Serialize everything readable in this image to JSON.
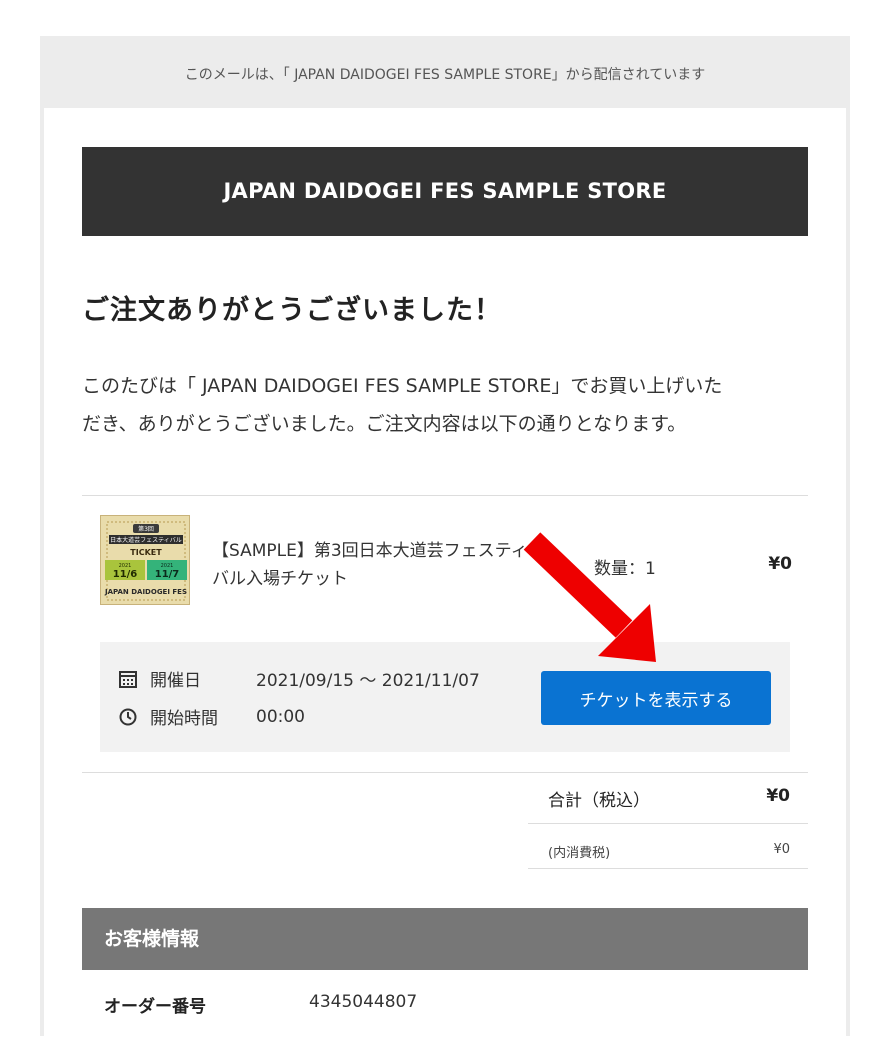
{
  "notice": {
    "text": "このメールは、「 JAPAN DAIDOGEI FES SAMPLE STORE」から配信されています"
  },
  "store": {
    "name": "JAPAN DAIDOGEI FES SAMPLE STORE"
  },
  "thanks": {
    "title": "ご注文ありがとうございました！",
    "line1": "このたびは「 JAPAN DAIDOGEI FES SAMPLE STORE」でお買い上げいた",
    "line2": "だき、ありがとうございました。ご注文内容は以下の通りとなります。"
  },
  "order_item": {
    "name": "【SAMPLE】第3回日本大道芸フェスティバル入場チケット",
    "quantity": "数量：1",
    "price": "¥0",
    "image_text": {
      "badge": "第3回",
      "festival": "日本大道芸フェスティバル",
      "ticket": "TICKET",
      "day1_year": "2021",
      "day1": "11/6",
      "day2_year": "2021",
      "day2": "11/7",
      "logo": "JAPAN DAIDOGEI FES"
    }
  },
  "event": {
    "date_label": "開催日",
    "date_value": "2021/09/15 〜 2021/11/07",
    "time_label": "開始時間",
    "time_value": "00:00",
    "button_label": "チケットを表示する",
    "icons": {
      "date": "calendar-icon",
      "time": "clock-icon"
    }
  },
  "totals": {
    "total_label": "合計（税込）",
    "total_value": "¥0",
    "tax_label": "(内消費税)",
    "tax_value": "¥0"
  },
  "customer": {
    "header": "お客様情報",
    "order_number_label": "オーダー番号",
    "order_number_value": "4345044807"
  },
  "colors": {
    "button": "#0a73d2",
    "header_dark": "#333333",
    "header_gray": "#777777",
    "arrow": "#ee0000"
  }
}
